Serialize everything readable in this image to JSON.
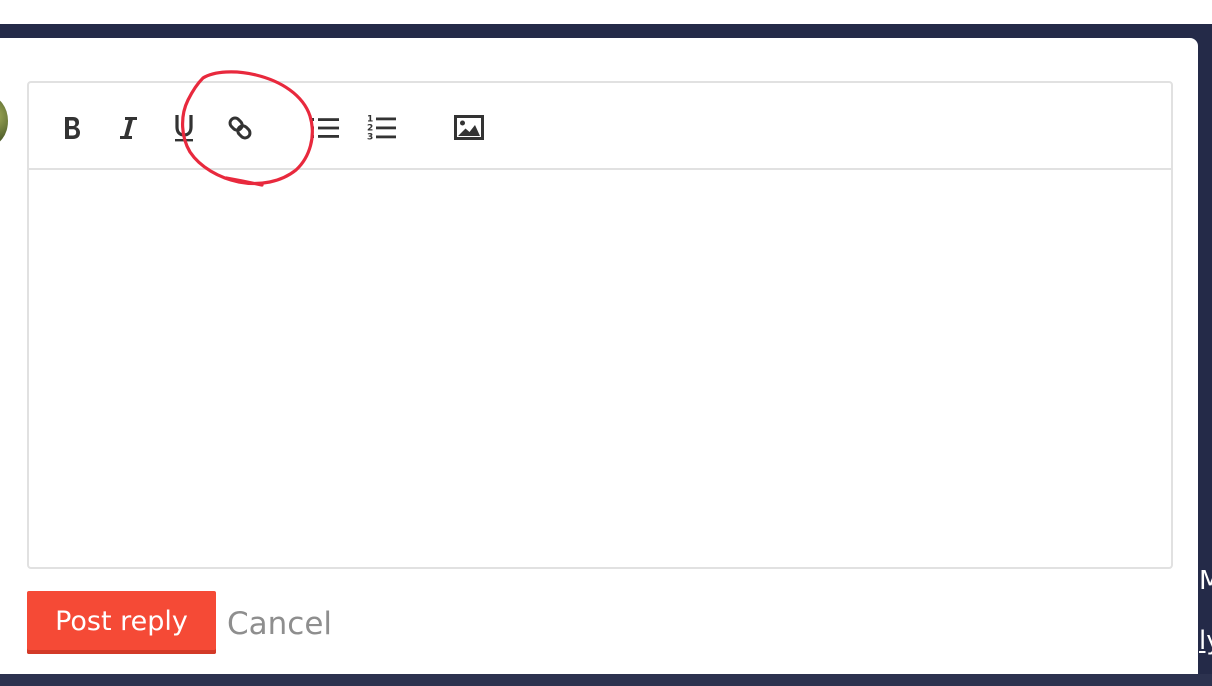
{
  "toolbar": {
    "buttons": [
      {
        "name": "bold",
        "icon": "bold-icon"
      },
      {
        "name": "italic",
        "icon": "italic-icon"
      },
      {
        "name": "underline",
        "icon": "underline-icon"
      },
      {
        "name": "link",
        "icon": "link-icon"
      },
      {
        "name": "bullet-list",
        "icon": "bullet-list-icon"
      },
      {
        "name": "numbered-list",
        "icon": "numbered-list-icon"
      },
      {
        "name": "image",
        "icon": "image-icon"
      }
    ],
    "annotation": {
      "shape": "freehand-circle",
      "target": "link-icon",
      "color": "#e8293d"
    }
  },
  "editor": {
    "content": ""
  },
  "actions": {
    "post_label": "Post reply",
    "cancel_label": "Cancel"
  },
  "edge": {
    "text_1": "M",
    "text_2": "ly"
  },
  "colors": {
    "backdrop": "#242a48",
    "post_button": "#f54a36",
    "cancel_text": "#8e8e8e",
    "border": "#e1e1e1",
    "annotation": "#e8293d"
  }
}
